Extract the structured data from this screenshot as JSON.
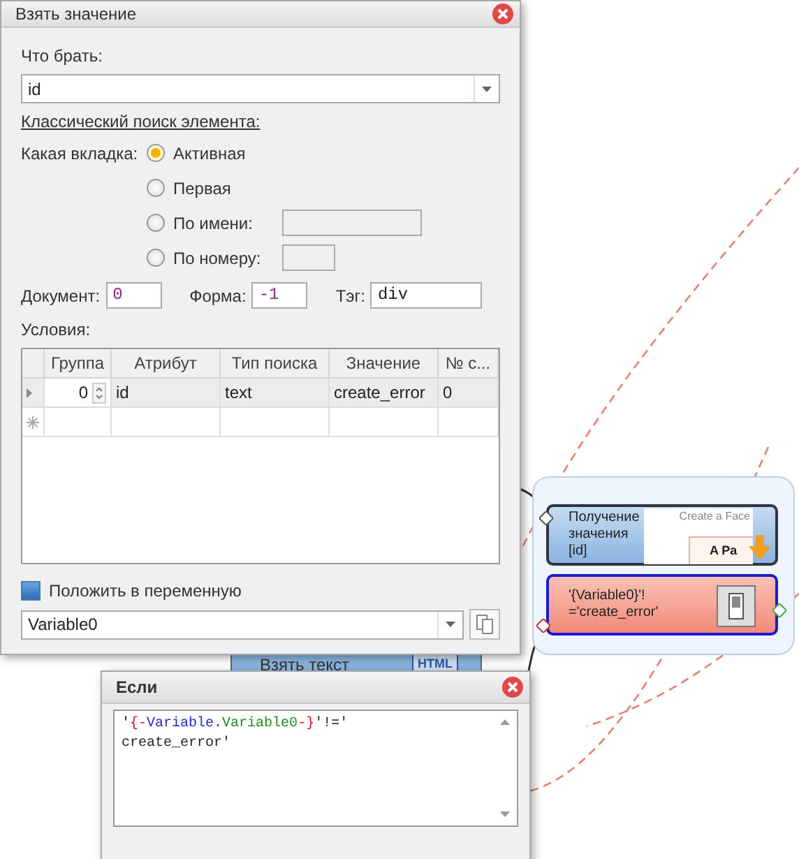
{
  "main_dialog": {
    "title": "Взять значение",
    "what_label": "Что брать:",
    "what_value": "id",
    "section_link": "Классический поиск элемента:",
    "tab_label": "Какая вкладка:",
    "tab_options": [
      {
        "label": "Активная",
        "selected": true,
        "kind": "plain"
      },
      {
        "label": "Первая",
        "selected": false,
        "kind": "plain"
      },
      {
        "label": "По имени:",
        "selected": false,
        "kind": "wide"
      },
      {
        "label": "По номеру:",
        "selected": false,
        "kind": "narrow"
      }
    ],
    "fields": [
      {
        "label": "Документ:",
        "value": "0",
        "kind": "number"
      },
      {
        "label": "Форма:",
        "value": "-1",
        "kind": "number"
      },
      {
        "label": "Тэг:",
        "value": "div",
        "kind": "text"
      }
    ],
    "conditions_label": "Условия:",
    "table": {
      "columns": [
        "Группа",
        "Атрибут",
        "Тип поиска",
        "Значение",
        "№ с..."
      ],
      "rows": [
        [
          "0",
          "id",
          "text",
          "create_error",
          "0"
        ]
      ]
    },
    "save_checkbox": {
      "label": "Положить в переменную",
      "checked": true
    },
    "variable": "Variable0"
  },
  "hidden_node": {
    "label": "Взять текст",
    "badge": "HTML"
  },
  "if_dialog": {
    "title": "Если",
    "code_lines": [
      [
        {
          "text": "'",
          "kind": "plain"
        },
        {
          "text": "{-",
          "kind": "brace"
        },
        {
          "text": "Variable.",
          "kind": "scope"
        },
        {
          "text": "Variable0",
          "kind": "name"
        },
        {
          "text": "-}",
          "kind": "brace"
        },
        {
          "text": "'!='",
          "kind": "plain"
        }
      ],
      [
        {
          "text": "create_error'",
          "kind": "plain"
        }
      ]
    ]
  },
  "nodes": [
    {
      "kind": "action",
      "lines": [
        "Получение",
        "значения",
        "[id]"
      ],
      "selected": false,
      "thumb_title": "Create a Face",
      "thumb_text": "A Pa"
    },
    {
      "kind": "condition",
      "lines": [
        "'{Variable0}'!",
        "='create_error'"
      ],
      "selected": true
    }
  ]
}
